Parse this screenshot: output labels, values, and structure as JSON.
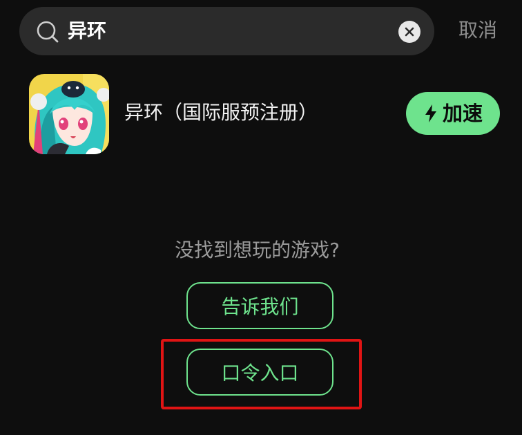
{
  "search": {
    "value": "异环"
  },
  "header": {
    "cancel_label": "取消"
  },
  "result": {
    "title": "异环（国际服预注册）",
    "action_label": "加速"
  },
  "empty_state": {
    "prompt": "没找到想玩的游戏?",
    "tell_us_label": "告诉我们",
    "code_entry_label": "口令入口"
  },
  "colors": {
    "accent": "#6ee38d",
    "background": "#0e0e0e",
    "search_bg": "#2b2b2b",
    "highlight": "#e01414"
  },
  "icons": {
    "search": "search-icon",
    "clear": "close-icon",
    "boost": "lightning-bolt-icon"
  }
}
